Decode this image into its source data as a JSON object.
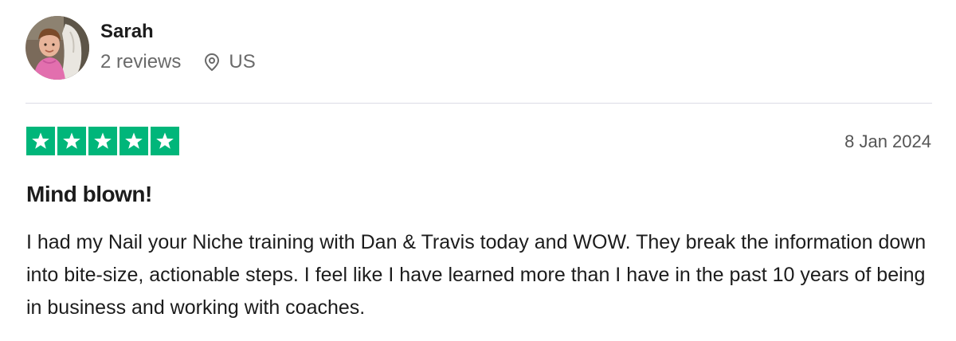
{
  "reviewer": {
    "name": "Sarah",
    "review_count": "2 reviews",
    "location": "US",
    "avatar_icon": "profile-photo"
  },
  "review": {
    "rating": 5,
    "max_rating": 5,
    "star_color": "#00b67a",
    "date": "8 Jan 2024",
    "title": "Mind blown!",
    "body": "I had my Nail your Niche training with Dan & Travis today and WOW. They break the information down into bite-size, actionable steps. I feel like I have learned more than I have in the past 10 years of being in business and working with coaches."
  },
  "icons": {
    "location": "map-pin-icon",
    "star": "star-icon"
  }
}
